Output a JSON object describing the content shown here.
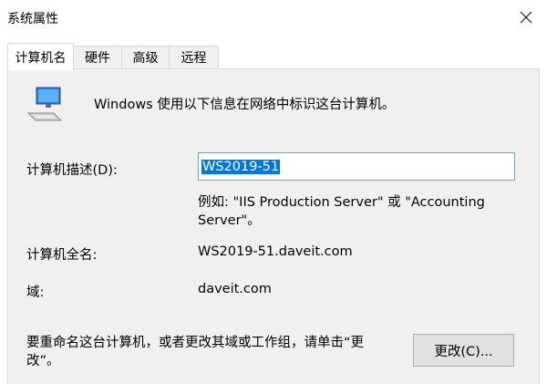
{
  "window": {
    "title": "系统属性"
  },
  "tabs": [
    {
      "label": "计算机名",
      "active": true
    },
    {
      "label": "硬件",
      "active": false
    },
    {
      "label": "高级",
      "active": false
    },
    {
      "label": "远程",
      "active": false
    }
  ],
  "panel": {
    "intro": "Windows 使用以下信息在网络中标识这台计算机。",
    "description_label": "计算机描述(D):",
    "description_value": "WS2019-51",
    "example_line1": "例如: \"IIS Production Server\" 或 \"Accounting",
    "example_line2": "Server\"。",
    "full_name_label": "计算机全名:",
    "full_name_value": "WS2019-51.daveit.com",
    "domain_label": "域:",
    "domain_value": "daveit.com",
    "rename_line1": "要重命名这台计算机，或者更改其域或工作组，请单击“更",
    "rename_line2": "改”。",
    "change_button": "更改(C)..."
  },
  "icons": {
    "close": "close-icon",
    "computer": "computer-network-icon"
  },
  "colors": {
    "selection": "#0078d7",
    "panel_bg": "#f0f0f0",
    "button_bg": "#e1e1e1"
  }
}
